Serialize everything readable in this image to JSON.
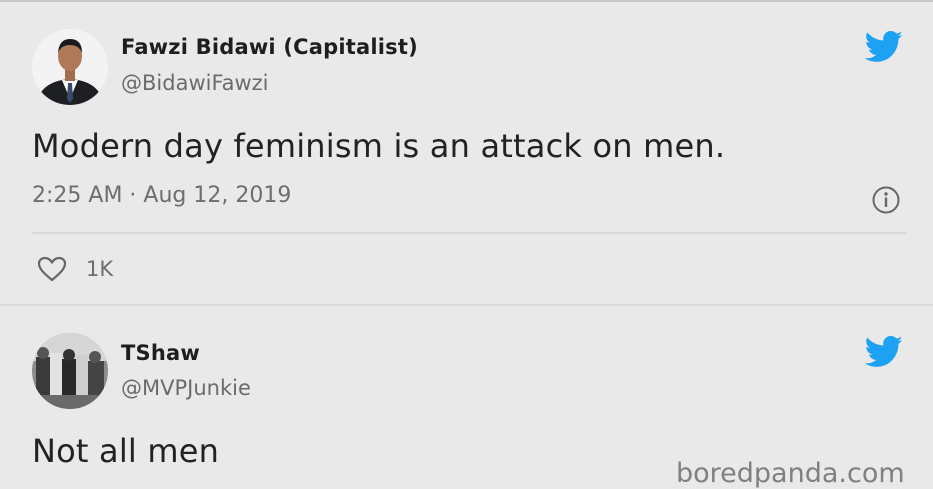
{
  "tweets": [
    {
      "name": "Fawzi Bidawi (Capitalist)",
      "handle": "@BidawiFawzi",
      "text": "Modern day feminism is an attack on men.",
      "timestamp": "2:25 AM · Aug 12, 2019",
      "likes": "1K",
      "icons": [
        "avatar",
        "twitter-bird-icon",
        "info-icon",
        "heart-icon"
      ]
    },
    {
      "name": "TShaw",
      "handle": "@MVPJunkie",
      "text": "Not all men",
      "icons": [
        "avatar",
        "twitter-bird-icon"
      ]
    }
  ],
  "watermark": "boredpanda.com",
  "colors": {
    "background": "#e9e9e9",
    "twitter_blue": "#1da1f2",
    "secondary_text": "#6e6e6e"
  }
}
